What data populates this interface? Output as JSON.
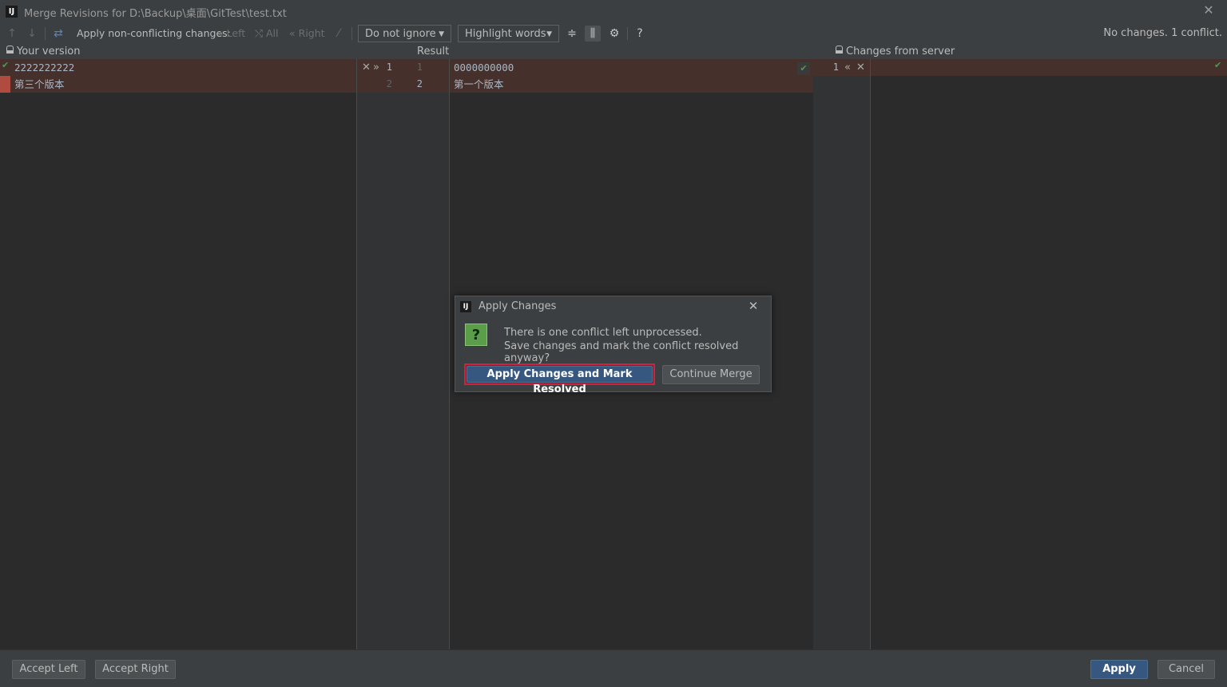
{
  "window": {
    "title": "Merge Revisions for D:\\Backup\\桌面\\GitTest\\test.txt",
    "close_glyph": "✕"
  },
  "toolbar": {
    "apply_non_conflicting_label": "Apply non-conflicting changes:",
    "left_label": "Left",
    "all_label": "All",
    "right_label": "Right",
    "ignore_combo_value": "Do not ignore",
    "highlight_combo_value": "Highlight words",
    "help_label": "?",
    "status": "No changes. 1 conflict."
  },
  "headers": {
    "left": "Your version",
    "middle": "Result",
    "right": "Changes from server"
  },
  "left_editor": {
    "lines": [
      "2222222222",
      "第三个版本"
    ]
  },
  "middle_gutter": {
    "left_line_numbers": [
      "1",
      "2"
    ],
    "right_line_numbers": [
      "1",
      "2"
    ]
  },
  "middle_editor": {
    "lines": [
      "0000000000",
      "第一个版本"
    ]
  },
  "right_gutter": {
    "line_number": "1"
  },
  "dialog": {
    "title": "Apply Changes",
    "message_line1": "There is one conflict left unprocessed.",
    "message_line2": "Save changes and mark the conflict resolved anyway?",
    "ok_label": "Apply Changes and Mark Resolved",
    "cancel_label": "Continue Merge",
    "close_glyph": "✕"
  },
  "bottom": {
    "accept_left_label": "Accept Left",
    "accept_right_label": "Accept Right",
    "apply_label": "Apply",
    "cancel_label": "Cancel"
  },
  "colors": {
    "background": "#2b2b2b",
    "panel": "#3c3f41",
    "conflict": "#45302b",
    "accent_button": "#365880",
    "highlight_outline": "#d4203a",
    "check": "#499c54"
  }
}
